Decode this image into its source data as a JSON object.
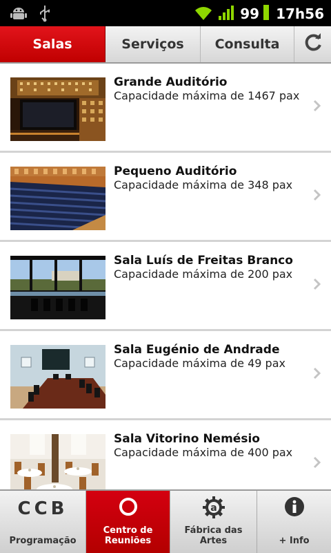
{
  "status_bar": {
    "battery": "99",
    "time": "17h56",
    "icons": [
      "android-debug-icon",
      "usb-icon",
      "wifi-icon",
      "signal-icon",
      "battery-icon"
    ]
  },
  "tabs": [
    {
      "label": "Salas",
      "active": true
    },
    {
      "label": "Serviços",
      "active": false
    },
    {
      "label": "Consulta",
      "active": false
    }
  ],
  "refresh_icon": "refresh-icon",
  "rooms": [
    {
      "title": "Grande Auditório",
      "subtitle": "Capacidade máxima de 1467 pax"
    },
    {
      "title": "Pequeno Auditório",
      "subtitle": "Capacidade máxima de 348 pax"
    },
    {
      "title": "Sala Luís de Freitas Branco",
      "subtitle": "Capacidade máxima de 200 pax"
    },
    {
      "title": "Sala Eugénio de Andrade",
      "subtitle": "Capacidade máxima de 49 pax"
    },
    {
      "title": "Sala Vitorino Nemésio",
      "subtitle": "Capacidade máxima de 400 pax"
    }
  ],
  "bottom_nav": {
    "programacao": {
      "logo": "CCB",
      "label": "Programação"
    },
    "reunioes": {
      "label": "Centro de\nReuniões",
      "active": true
    },
    "fabrica": {
      "label": "Fábrica das\nArtes"
    },
    "info": {
      "label": "+ Info"
    }
  },
  "colors": {
    "accent": "#d40010",
    "statusbar": "#000000",
    "signal_green": "#8ed600"
  }
}
